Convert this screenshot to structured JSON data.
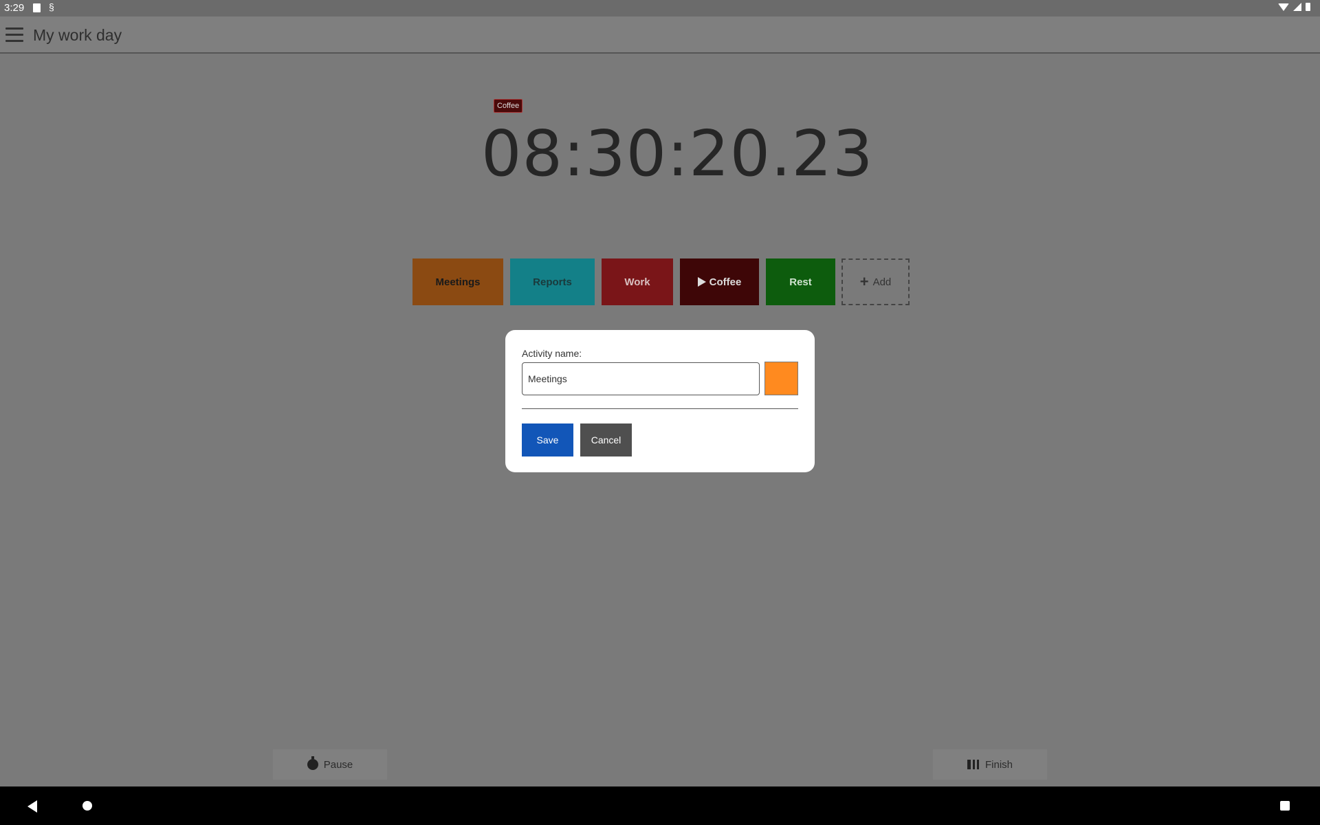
{
  "status_bar": {
    "time": "3:29"
  },
  "app_bar": {
    "title": "My work day"
  },
  "timer": {
    "current_activity": "Coffee",
    "elapsed": "08:30:20.23"
  },
  "activities": [
    {
      "label": "Meetings",
      "color": "#8b4a12",
      "text_color": "#1a1a1a",
      "playing": false
    },
    {
      "label": "Reports",
      "color": "#138088",
      "text_color": "#1a3a3c",
      "playing": false
    },
    {
      "label": "Work",
      "color": "#7a1518",
      "text_color": "#d8c0c0",
      "playing": false
    },
    {
      "label": "Coffee",
      "color": "#3e0607",
      "text_color": "#dddddd",
      "playing": true
    },
    {
      "label": "Rest",
      "color": "#0d5c0d",
      "text_color": "#cfe3cf",
      "playing": false
    }
  ],
  "add_button": {
    "label": "Add"
  },
  "bottom": {
    "pause_label": "Pause",
    "finish_label": "Finish"
  },
  "dialog": {
    "label": "Activity name:",
    "input_value": "Meetings",
    "selected_color": "#ff8a1f",
    "save_label": "Save",
    "cancel_label": "Cancel"
  }
}
